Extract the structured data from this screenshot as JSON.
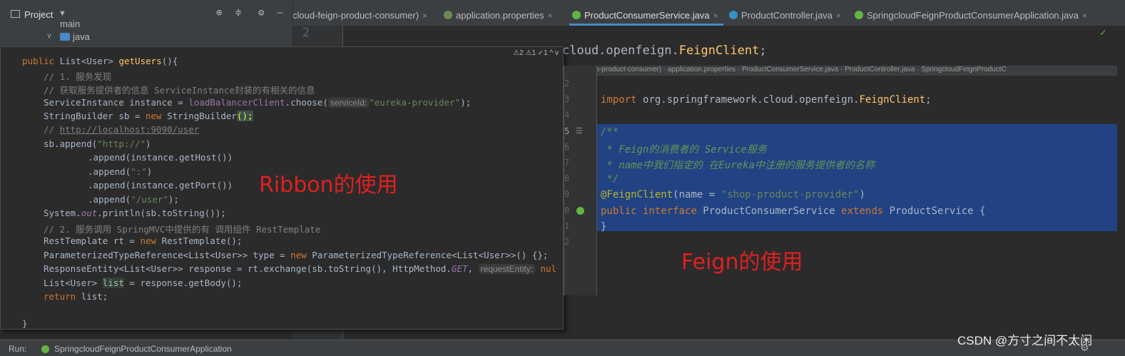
{
  "project": {
    "title": "Project",
    "tree": [
      "main",
      "java"
    ]
  },
  "tabs": [
    {
      "label": "cloud-feign-product-consumer)",
      "icon_color": "#9aa"
    },
    {
      "label": "application.properties",
      "icon_color": "#6a8759"
    },
    {
      "label": "ProductConsumerService.java",
      "icon_color": "#62b543"
    },
    {
      "label": "ProductController.java",
      "icon_color": "#3592c4"
    },
    {
      "label": "SpringcloudFeignProductConsumerApplication.java",
      "icon_color": "#62b543"
    }
  ],
  "editor": {
    "line_number": "2",
    "import_tail_prefix": "cloud.openfeign.",
    "import_tail_class": "FeignClient",
    "import_tail_end": ";"
  },
  "left_code": {
    "warnings": "⚠2 ⚠1 ✓1 ^ v",
    "lines": {
      "l1a": "public ",
      "l1b": "List<User> ",
      "l1c": "getUsers",
      "l1d": "(){",
      "l2": "// 1. 服务发现",
      "l3": "// 获取服务提供者的信息 ServiceInstance封装的有相关的信息",
      "l4a": "ServiceInstance instance = ",
      "l4b": "loadBalancerClient",
      "l4c": ".choose(",
      "l4hint": "serviceId:",
      "l4d": "\"eureka-provider\"",
      "l4e": ");",
      "l5a": "StringBuilder sb = ",
      "l5b": "new ",
      "l5c": "StringBuilder",
      "l5d": "();",
      "l6a": "// ",
      "l6b": "http://localhost:9090/user",
      "l7a": "sb.append(",
      "l7b": "\"http://\"",
      "l7c": ")",
      "l8": ".append(instance.getHost())",
      "l9a": ".append(",
      "l9b": "\":\"",
      "l9c": ")",
      "l10": ".append(instance.getPort())",
      "l11a": ".append(",
      "l11b": "\"/user\"",
      "l11c": ");",
      "l12a": "System.",
      "l12b": "out",
      "l12c": ".println(sb.toString());",
      "l13": "// 2. 服务调用 SpringMVC中提供的有 调用组件 RestTemplate",
      "l14a": "RestTemplate rt = ",
      "l14b": "new ",
      "l14c": "RestTemplate();",
      "l15a": "ParameterizedTypeReference<List<User>> type = ",
      "l15b": "new ",
      "l15c": "ParameterizedTypeReference<List<User>>() {};",
      "l16a": "ResponseEntity<List<User>> response = rt.exchange(sb.toString(), HttpMethod.",
      "l16b": "GET",
      "l16c": ", ",
      "l16hint": "requestEntity:",
      "l16d": " nul",
      "l17a": "List<User> ",
      "l17b": "list",
      "l17c": " = response.getBody();",
      "l18a": "return ",
      "l18b": "list;",
      "l19": "}"
    },
    "label": "Ribbon的使用"
  },
  "right_code": {
    "header": "cloud-feign-product-consumer)  ·  application.properties  ·  ProductConsumerService.java  ·  ProductController.java  ·  SpringcloudFeignProductC",
    "line_numbers": [
      "2",
      "3",
      "4",
      "5",
      "6",
      "7",
      "8",
      "9",
      "0",
      "1",
      "2"
    ],
    "import_a": "import ",
    "import_b": "org.springframework.cloud.openfeign.",
    "import_c": "FeignClient",
    "import_d": ";",
    "doc1": "/**",
    "doc2": " * Feign的消费者的 Service服务",
    "doc3": " * name中我们指定的 在Eureka中注册的服务提供者的名称",
    "doc4": " */",
    "ann_a": "@FeignClient",
    "ann_b": "(name = ",
    "ann_c": "\"shop-product-provider\"",
    "ann_d": ")",
    "decl_a": "public interface ",
    "decl_b": "ProductConsumerService ",
    "decl_c": "extends ",
    "decl_d": "ProductService {",
    "close": "}",
    "label": "Feign的使用"
  },
  "bottom": {
    "run_label": "Run:",
    "run_config": "SpringcloudFeignProductConsumerApplication"
  },
  "watermark": "CSDN @方寸之间不太闲"
}
